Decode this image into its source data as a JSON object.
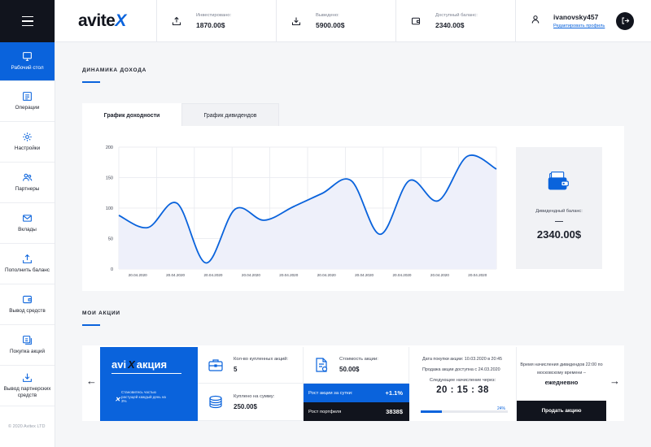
{
  "sidebar": {
    "items": [
      {
        "label": "Рабочий стол",
        "icon": "desktop-icon"
      },
      {
        "label": "Операции",
        "icon": "list-icon"
      },
      {
        "label": "Настройки",
        "icon": "gear-icon"
      },
      {
        "label": "Партнеры",
        "icon": "partners-icon"
      },
      {
        "label": "Вклады",
        "icon": "mail-icon"
      },
      {
        "label": "Пополнить баланс",
        "icon": "upload-icon"
      },
      {
        "label": "Вывод средств",
        "icon": "wallet-icon"
      },
      {
        "label": "Покупка акций",
        "icon": "shares-icon"
      },
      {
        "label": "Вывод партнерских средств",
        "icon": "download-icon"
      }
    ],
    "copyright": "© 2020 Avitex LTD"
  },
  "header": {
    "logo_main": "avite",
    "logo_accent": "X",
    "stats": [
      {
        "label": "Инвестировано:",
        "value": "1870.00$"
      },
      {
        "label": "Выведено:",
        "value": "5900.00$"
      },
      {
        "label": "Доступный баланс:",
        "value": "2340.00$"
      }
    ],
    "username": "ivanovsky457",
    "profile_link": "Редактировать профиль"
  },
  "income": {
    "title": "ДИНАМИКА ДОХОДА",
    "tabs": [
      "График доходности",
      "График дивидендов"
    ],
    "dividend_label": "Дивидендный баланс:",
    "dividend_value": "2340.00$"
  },
  "chart_data": {
    "type": "line",
    "ylim": [
      0,
      200
    ],
    "y_ticks": [
      "0",
      "50",
      "100",
      "150",
      "200"
    ],
    "x_ticks": [
      "20.04.2020",
      "20.04.2020",
      "20.04.2020",
      "20.04.2020",
      "20.04.2020",
      "20.04.2020",
      "20.04.2020",
      "20.04.2020",
      "20.04.2020",
      "20.04.2020"
    ],
    "series": [
      {
        "values": [
          88,
          68,
          108,
          10,
          98,
          80,
          102,
          124,
          145,
          57,
          145,
          112,
          185,
          164
        ]
      }
    ],
    "grid": true,
    "color": "#0a63dc"
  },
  "shares": {
    "title": "МОИ АКЦИИ",
    "banner_brand": "avi",
    "banner_x": "X",
    "banner_word": "акция",
    "banner_tag": "Становитесь частью растущей  каждый день на 3%",
    "count_label": "Кол-во купленных акций:",
    "count_value": "5",
    "cost_label": "Стоимость акции:",
    "cost_value": "50.00$",
    "bought_label": "Куплено на сумму:",
    "bought_value": "250.00$",
    "growth_day_label": "Рост акции за сутки:",
    "growth_day_value": "+1.1%",
    "growth_portfolio_label": "Рост портфеля",
    "growth_portfolio_value": "3838$",
    "purchase_date": "Дата покупки акции: 10.03.2020 в 20:45",
    "sale_date": "Продажа акции доступна с 24.03.2020",
    "next_label": "Следующее начисление через:",
    "timer": "20 : 15 : 38",
    "progress_text": "24%",
    "progress": 0.24,
    "accrual_text": "Время начисления дивидендов 22:00 по московскому времени –",
    "accrual_value": "ежедневно",
    "sell_button": "Продать акцию"
  }
}
